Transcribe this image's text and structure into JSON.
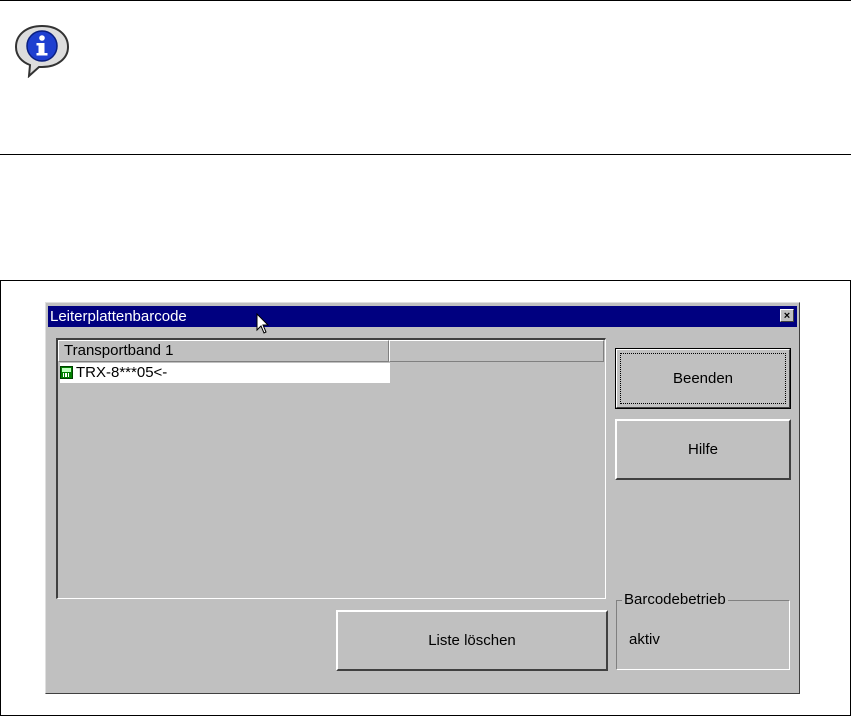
{
  "dialog": {
    "title": "Leiterplattenbarcode",
    "close_symbol": "×"
  },
  "list": {
    "columns": [
      "Transportband 1",
      ""
    ],
    "rows": [
      {
        "icon": "barcode-item-icon",
        "text": "TRX-8***05<-"
      }
    ]
  },
  "buttons": {
    "beenden": "Beenden",
    "hilfe": "Hilfe",
    "liste_loeschen": "Liste löschen"
  },
  "barcode_group": {
    "title": "Barcodebetrieb",
    "status": "aktiv"
  },
  "icons": {
    "info": "info-icon",
    "cursor": "mouse-cursor-icon"
  },
  "colors": {
    "titlebar": "#000080",
    "dialog_face": "#c0c0c0"
  }
}
